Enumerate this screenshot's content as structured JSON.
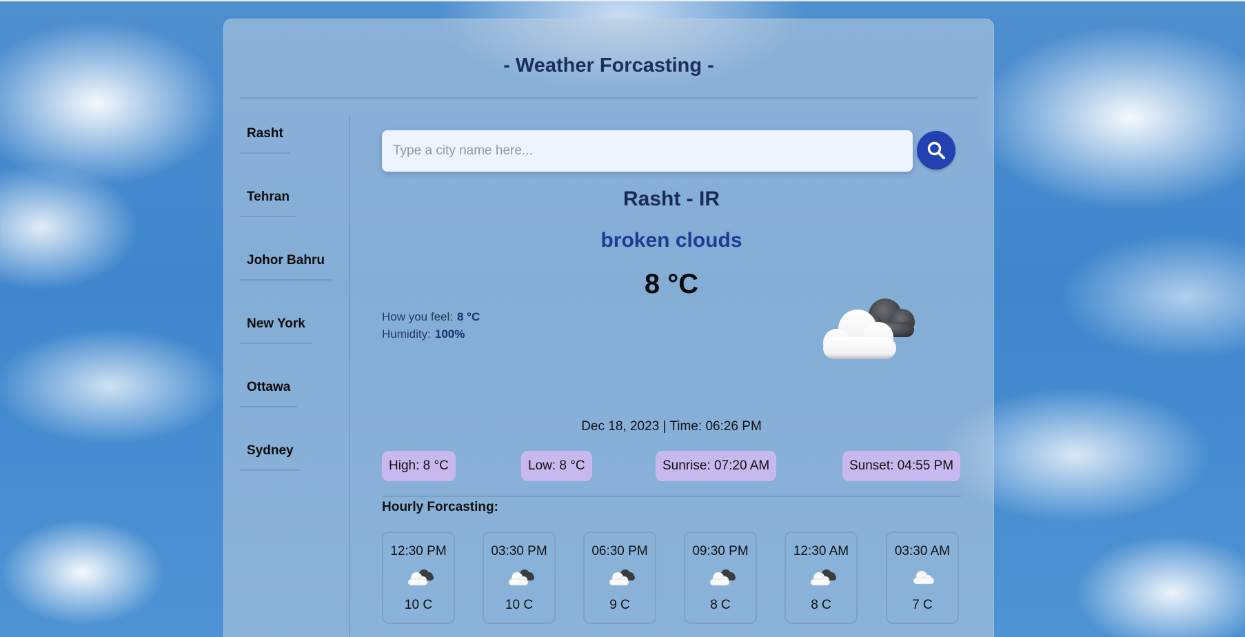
{
  "app": {
    "title": "- Weather Forcasting -"
  },
  "sidebar": {
    "cities": [
      {
        "label": "Rasht"
      },
      {
        "label": "Tehran"
      },
      {
        "label": "Johor Bahru"
      },
      {
        "label": "New York"
      },
      {
        "label": "Ottawa"
      },
      {
        "label": "Sydney"
      }
    ]
  },
  "search": {
    "placeholder": "Type a city name here...",
    "value": "",
    "button_icon": "search-icon"
  },
  "current": {
    "location": "Rasht - IR",
    "description": "broken clouds",
    "temperature": "8 °C",
    "feels_like_label": "How you feel:",
    "feels_like_value": "8 °C",
    "humidity_label": "Humidity:",
    "humidity_value": "100%",
    "icon": "broken-clouds-icon",
    "datetime": "Dec 18, 2023 | Time: 06:26 PM",
    "high": "High: 8 °C",
    "low": "Low: 8 °C",
    "sunrise": "Sunrise: 07:20 AM",
    "sunset": "Sunset: 04:55 PM"
  },
  "hourly": {
    "title": "Hourly Forcasting:",
    "items": [
      {
        "time": "12:30 PM",
        "icon": "broken-clouds-icon",
        "temp": "10 C"
      },
      {
        "time": "03:30 PM",
        "icon": "broken-clouds-icon",
        "temp": "10 C"
      },
      {
        "time": "06:30 PM",
        "icon": "broken-clouds-icon",
        "temp": "9 C"
      },
      {
        "time": "09:30 PM",
        "icon": "broken-clouds-icon",
        "temp": "8 C"
      },
      {
        "time": "12:30 AM",
        "icon": "broken-clouds-icon",
        "temp": "8 C"
      },
      {
        "time": "03:30 AM",
        "icon": "cloud-icon",
        "temp": "7 C"
      }
    ]
  },
  "colors": {
    "accent": "#2341b1",
    "title": "#1c2d5f",
    "description": "#213a94",
    "pill": "#c8b8ee"
  }
}
